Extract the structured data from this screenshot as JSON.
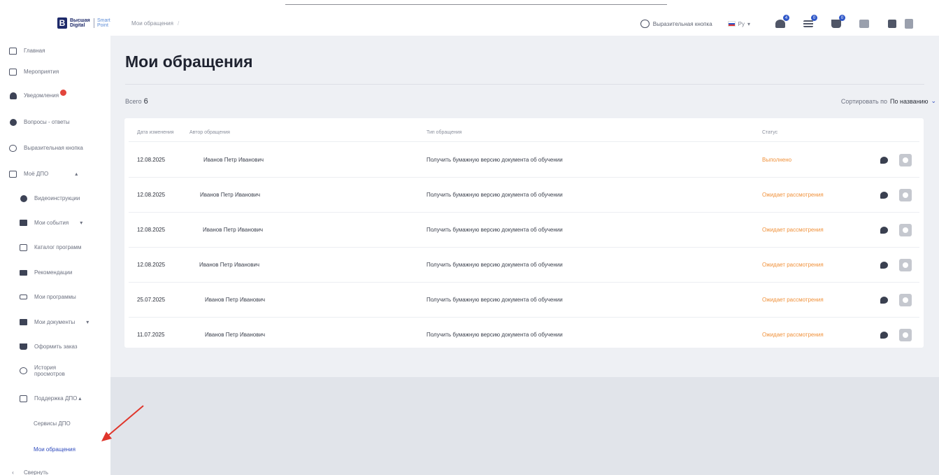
{
  "header": {
    "logo_title": "Высшая Digital",
    "logo_sub": "Smart Point",
    "breadcrumb": "Мои обращения",
    "expressive_button": "Выразительная кнопка",
    "language": "Ру",
    "icons": [
      {
        "name": "heart-icon",
        "badge": "4"
      },
      {
        "name": "list-icon",
        "badge": "0"
      },
      {
        "name": "cart-icon",
        "badge": "0"
      },
      {
        "name": "comparison-icon",
        "badge": ""
      },
      {
        "name": "logout-icon",
        "badge": ""
      }
    ]
  },
  "sidebar": {
    "items": [
      {
        "label": "Главная",
        "icon": "home-icon"
      },
      {
        "label": "Мероприятия",
        "icon": "calendar-icon"
      },
      {
        "label": "Уведомления",
        "icon": "bell-icon"
      },
      {
        "label": "Вопросы - ответы",
        "icon": "question-icon"
      },
      {
        "label": "Выразительная кнопка",
        "icon": "speech-icon"
      },
      {
        "label": "Моё ДПО",
        "icon": "dpo-icon",
        "caret": "▴"
      },
      {
        "label": "Видеоинструкции",
        "icon": "video-icon"
      },
      {
        "label": "Мои события",
        "icon": "events-icon",
        "caret": "▾"
      },
      {
        "label": "Каталог программ",
        "icon": "catalog-icon"
      },
      {
        "label": "Рекомендации",
        "icon": "recommend-icon"
      },
      {
        "label": "Мои программы",
        "icon": "graduation-icon"
      },
      {
        "label": "Мои документы",
        "icon": "folder-icon",
        "caret": "▾"
      },
      {
        "label": "Оформить заказ",
        "icon": "cart-icon"
      },
      {
        "label": "История просмотров",
        "icon": "clock-icon"
      },
      {
        "label": "Поддержка ДПО",
        "icon": "support-icon",
        "caret": "▴"
      },
      {
        "label": "Сервисы ДПО",
        "icon": ""
      },
      {
        "label": "Мои обращения",
        "icon": ""
      },
      {
        "label": "Свернуть",
        "icon": "chevron-left-icon"
      }
    ]
  },
  "main": {
    "title": "Мои обращения",
    "total_label": "Всего",
    "total_value": "6",
    "sort_label": "Сортировать по",
    "sort_value": "По названию",
    "columns": [
      "Дата изменения",
      "Автор обращения",
      "Тип обращения",
      "Статус"
    ],
    "rows": [
      {
        "date": "12.08.2025",
        "author": "Иванов Петр Иванович",
        "type": "Получить бумажную версию документа об обучении",
        "status": "Выполнено"
      },
      {
        "date": "12.08.2025",
        "author": "Иванов Петр Иванович",
        "type": "Получить бумажную версию документа об обучении",
        "status": "Ожидает рассмотрения"
      },
      {
        "date": "12.08.2025",
        "author": "Иванов Петр Иванович",
        "type": "Получить бумажную версию документа об обучении",
        "status": "Ожидает рассмотрения"
      },
      {
        "date": "12.08.2025",
        "author": "Иванов Петр Иванович",
        "type": "Получить бумажную версию документа об обучении",
        "status": "Ожидает рассмотрения"
      },
      {
        "date": "25.07.2025",
        "author": "Иванов Петр Иванович",
        "type": "Получить бумажную версию документа об обучении",
        "status": "Ожидает рассмотрения"
      },
      {
        "date": "11.07.2025",
        "author": "Иванов Петр Иванович",
        "type": "Получить бумажную версию документа об обучении",
        "status": "Ожидает рассмотрения"
      }
    ]
  },
  "colors": {
    "accent": "#2f4bbd",
    "status": "#f0913a",
    "annotation_arrow": "#e0352b"
  }
}
